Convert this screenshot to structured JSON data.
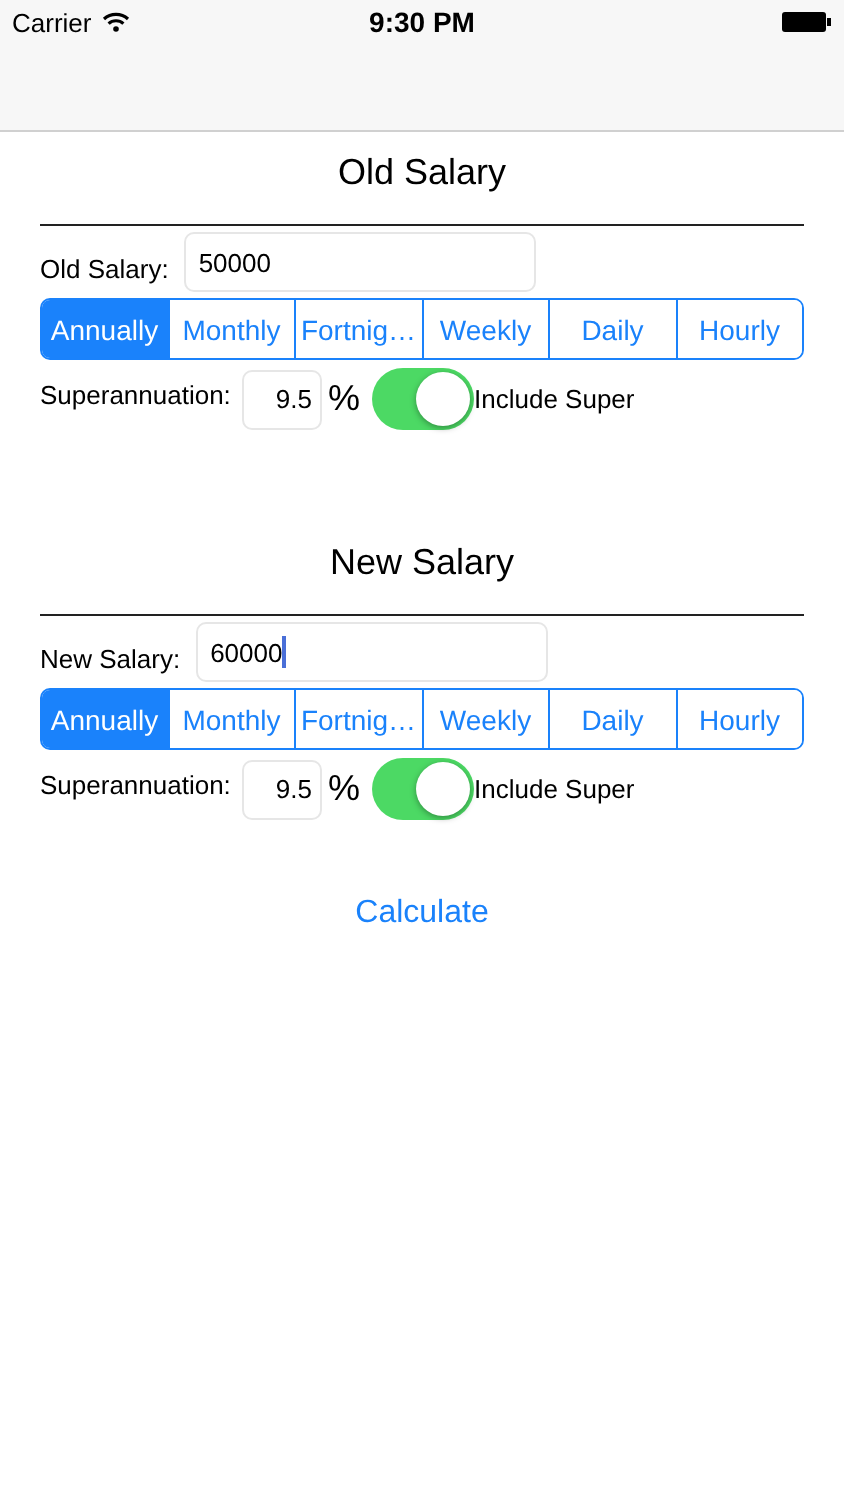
{
  "status_bar": {
    "carrier": "Carrier",
    "time": "9:30 PM"
  },
  "sections": [
    {
      "title": "Old Salary",
      "field_label": "Old Salary:",
      "value": "50000",
      "focused": false,
      "periods": [
        {
          "label": "Annually",
          "selected": true
        },
        {
          "label": "Monthly",
          "selected": false
        },
        {
          "label": "Fortnig…",
          "selected": false
        },
        {
          "label": "Weekly",
          "selected": false
        },
        {
          "label": "Daily",
          "selected": false
        },
        {
          "label": "Hourly",
          "selected": false
        }
      ],
      "super_label": "Superannuation:",
      "super_value": "9.5",
      "percent": "%",
      "include_super": {
        "label": "Include Super",
        "on": true
      }
    },
    {
      "title": "New Salary",
      "field_label": "New Salary:",
      "value": "60000",
      "focused": true,
      "periods": [
        {
          "label": "Annually",
          "selected": true
        },
        {
          "label": "Monthly",
          "selected": false
        },
        {
          "label": "Fortnig…",
          "selected": false
        },
        {
          "label": "Weekly",
          "selected": false
        },
        {
          "label": "Daily",
          "selected": false
        },
        {
          "label": "Hourly",
          "selected": false
        }
      ],
      "super_label": "Superannuation:",
      "super_value": "9.5",
      "percent": "%",
      "include_super": {
        "label": "Include Super",
        "on": true
      }
    }
  ],
  "calculate_button": "Calculate"
}
